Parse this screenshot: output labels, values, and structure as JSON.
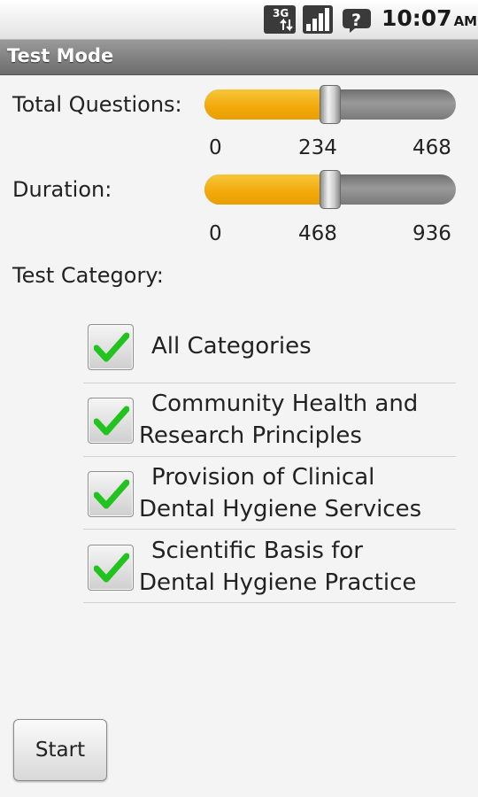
{
  "status_bar": {
    "network_label": "3G",
    "network_icon": "network-3g-icon",
    "signal_icon": "signal-strength-icon",
    "notification_icon": "question-notification-icon",
    "notification_glyph": "?",
    "time": "10:07",
    "ampm": "AM"
  },
  "title_bar": {
    "title": "Test Mode"
  },
  "total_questions": {
    "label": "Total Questions:",
    "min": "0",
    "mid": "234",
    "max": "468",
    "value": 234,
    "fraction": 0.5
  },
  "duration": {
    "label": "Duration:",
    "min": "0",
    "mid": "468",
    "max": "936",
    "value": 468,
    "fraction": 0.5
  },
  "test_category": {
    "label": "Test Category:",
    "items": [
      {
        "label": "All Categories",
        "checked": true
      },
      {
        "label": "Community Health and Research Principles",
        "line1": "Community Health and",
        "line2": "Research Principles",
        "checked": true
      },
      {
        "label": "Provision of Clinical Dental Hygiene Services",
        "line1": "Provision of Clinical",
        "line2": "Dental Hygiene Services",
        "checked": true
      },
      {
        "label": "Scientific Basis for Dental Hygiene Practice",
        "line1": "Scientific Basis for",
        "line2": "Dental Hygiene Practice",
        "checked": true
      }
    ]
  },
  "start_button": {
    "label": "Start"
  },
  "colors": {
    "slider_fill": "#f3a808",
    "slider_track": "#7a7a7a",
    "checkmark": "#22c21f",
    "title_bar": "#7c7c7c"
  }
}
